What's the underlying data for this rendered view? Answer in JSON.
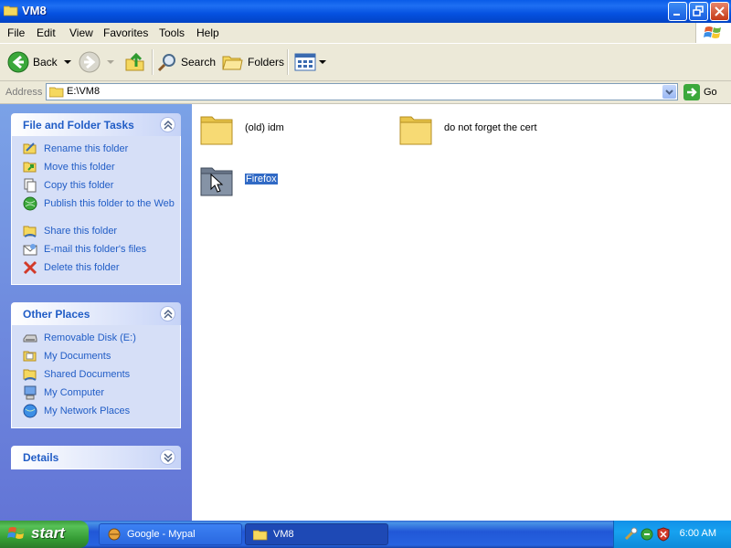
{
  "window": {
    "title": "VM8"
  },
  "menu": [
    "File",
    "Edit",
    "View",
    "Favorites",
    "Tools",
    "Help"
  ],
  "toolbar": {
    "back": "Back",
    "search": "Search",
    "folders": "Folders"
  },
  "address": {
    "label": "Address",
    "value": "E:\\VM8",
    "go": "Go"
  },
  "tasks_panel": {
    "title": "File and Folder Tasks",
    "items": [
      {
        "label": "Rename this folder",
        "icon": "rename-icon"
      },
      {
        "label": "Move this folder",
        "icon": "move-icon"
      },
      {
        "label": "Copy this folder",
        "icon": "copy-icon"
      },
      {
        "label": "Publish this folder to the Web",
        "icon": "publish-web-icon"
      },
      {
        "label": "Share this folder",
        "icon": "share-icon"
      },
      {
        "label": "E-mail this folder's files",
        "icon": "email-icon"
      },
      {
        "label": "Delete this folder",
        "icon": "delete-icon"
      }
    ]
  },
  "places_panel": {
    "title": "Other Places",
    "items": [
      {
        "label": "Removable Disk (E:)",
        "icon": "removable-disk-icon"
      },
      {
        "label": "My Documents",
        "icon": "my-documents-icon"
      },
      {
        "label": "Shared Documents",
        "icon": "shared-documents-icon"
      },
      {
        "label": "My Computer",
        "icon": "my-computer-icon"
      },
      {
        "label": "My Network Places",
        "icon": "network-places-icon"
      }
    ]
  },
  "details_panel": {
    "title": "Details"
  },
  "folders": [
    {
      "name": "(old) idm",
      "selected": false
    },
    {
      "name": "do not forget the cert",
      "selected": false
    },
    {
      "name": "Firefox",
      "selected": true
    }
  ],
  "taskbar": {
    "start": "start",
    "tasks": [
      {
        "label": "Google - Mypal",
        "active": false
      },
      {
        "label": "VM8",
        "active": true
      }
    ],
    "clock": "6:00 AM"
  },
  "colors": {
    "titlebar": "#0a5ce8",
    "taskpane": "#7ba2e7",
    "link": "#215dc6",
    "selection": "#316ac5"
  }
}
